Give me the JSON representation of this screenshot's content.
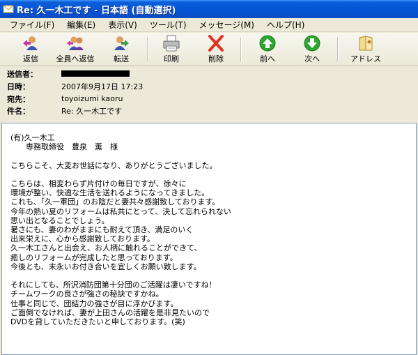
{
  "window": {
    "title": "Re: 久一木工です - 日本語 (自動選択)",
    "icon": "mail-envelope-icon"
  },
  "menu": [
    "ファイル(F)",
    "編集(E)",
    "表示(V)",
    "ツール(T)",
    "メッセージ(M)",
    "ヘルプ(H)"
  ],
  "toolbar": {
    "reply": "返信",
    "reply_all": "全員へ返信",
    "forward": "転送",
    "print": "印刷",
    "delete": "削除",
    "previous": "前へ",
    "next": "次へ",
    "addresses": "アドレス"
  },
  "headers": {
    "from_label": "送信者：",
    "date_label": "日時：",
    "date_value": "2007年9月17日 17:23",
    "to_label": "宛先：",
    "to_value": "toyoizumi kaoru",
    "subject_label": "件名：",
    "subject_value": "Re: 久一木工です"
  },
  "body": {
    "text": "(有)久一木工\n　　専務取締役　豊泉　薫　様\n\nこちらこそ、大変お世話になり、ありがとうございました。\n\nこちらは、相変わらず片付けの毎日ですが、徐々に\n環境が整い、快適な生活を送れるようになってきました。\nこれも、「久一軍団」のお陰だと妻共々感謝致しております。\n今年の熱い夏のリフォームは私共にとって、決して忘れられない\n思い出となることでしょう。\n暑さにも、妻のわがままにも耐えて頂き、満足のいく\n出来栄えに、心から感謝致しております。\n久一木工さんと出会え、お人柄に触れることができて、\n癒しのリフォームが完成したと思っております。\n今後とも、末永いお付き合いを宜しくお願い致します。\n\nそれにしても、所沢消防団第十分団のご活躍は凄いですね！\nチームワークの良さが強さの秘訣ですかね。\n仕事と同じで、団結力の強さが目に浮かびます。\nご面倒でなければ、妻が上田さんの活躍を是非見たいので\nDVDを貸していただきたいと申しております。(笑)"
  }
}
